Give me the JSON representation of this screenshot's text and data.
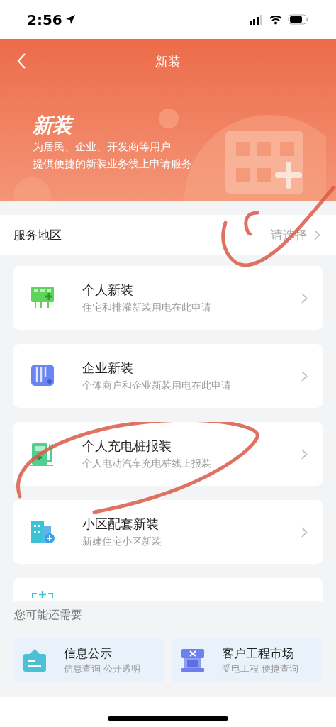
{
  "status_bar": {
    "time": "2:56"
  },
  "nav": {
    "title": "新装"
  },
  "hero": {
    "title": "新装",
    "lines": [
      "为居民、企业、开发商等用户",
      "提供便捷的新装业务线上申请服务"
    ]
  },
  "region": {
    "label": "服务地区",
    "placeholder": "请选择"
  },
  "services": [
    {
      "kind": "grid",
      "title": "个人新装",
      "subtitle": "住宅和排灌新装用电在此申请",
      "color": "#5fd35a"
    },
    {
      "kind": "cabinet",
      "title": "企业新装",
      "subtitle": "个体商户和企业新装用电在此申请",
      "color": "#6a84f0"
    },
    {
      "kind": "charger",
      "title": "个人充电桩报装",
      "subtitle": "个人电动汽车充电桩线上报装",
      "color": "#4fd08f"
    },
    {
      "kind": "building",
      "title": "小区配套新装",
      "subtitle": "新建住宅小区新装",
      "color": "#3cc3d8"
    },
    {
      "kind": "batch",
      "color": "#3cc3d8"
    }
  ],
  "more": {
    "heading": "您可能还需要",
    "items": [
      {
        "kind": "notice",
        "title": "信息公示",
        "subtitle": "信息查询 公开透明"
      },
      {
        "kind": "shop",
        "title": "客户工程市场",
        "subtitle": "受电工程 便捷查询"
      }
    ]
  }
}
